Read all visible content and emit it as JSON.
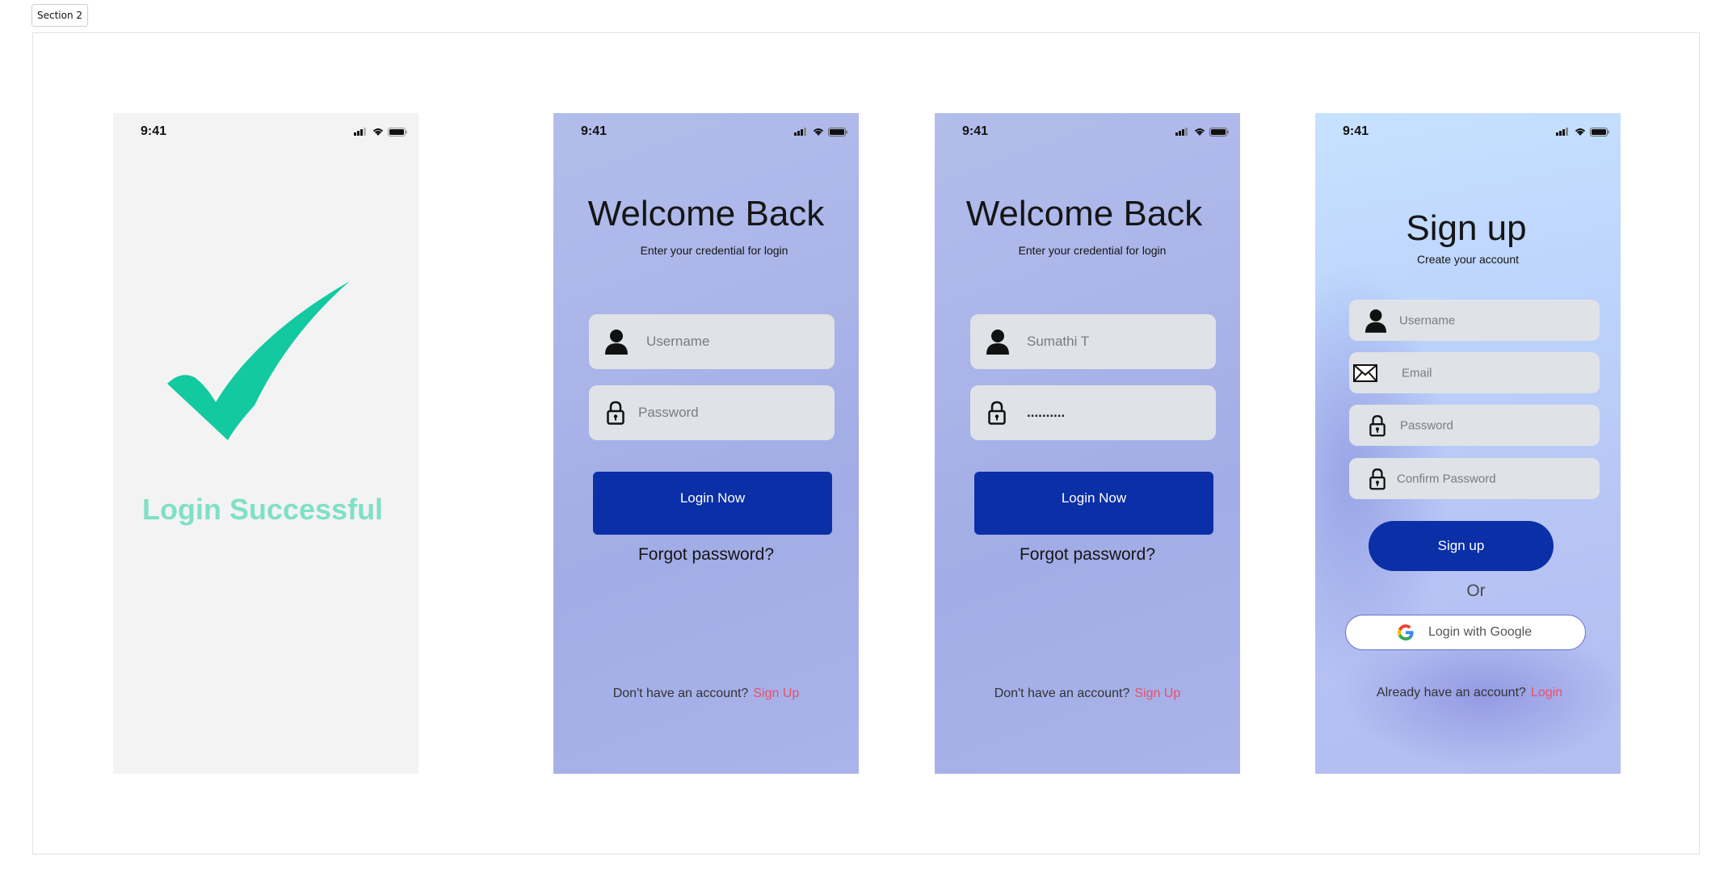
{
  "section_label": "Section 2",
  "status_bar": {
    "time": "9:41"
  },
  "screens": {
    "login_success": {
      "message": "Login Successful"
    },
    "login_empty": {
      "title": "Welcome Back",
      "subtitle": "Enter your credential for login",
      "username_placeholder": "Username",
      "password_placeholder": "Password",
      "login_button": "Login Now",
      "forgot_password": "Forgot password?",
      "footer_text": "Don't have an account?",
      "footer_link": "Sign Up"
    },
    "login_filled": {
      "title": "Welcome Back",
      "subtitle": "Enter your credential for login",
      "username_value": "Sumathi T",
      "password_value": "..........",
      "login_button": "Login Now",
      "forgot_password": "Forgot password?",
      "footer_text": "Don't have an account?",
      "footer_link": "Sign Up"
    },
    "signup": {
      "title": "Sign up",
      "subtitle": "Create your account",
      "username_placeholder": "Username",
      "email_placeholder": "Email",
      "password_placeholder": "Password",
      "confirm_password_placeholder": "Confirm Password",
      "signup_button": "Sign up",
      "or_text": "Or",
      "google_button": "Login with Google",
      "footer_text": "Already have an account?",
      "footer_link": "Login"
    }
  },
  "icons": {
    "checkmark": "checkmark-icon",
    "user": "user-icon",
    "lock": "lock-icon",
    "email": "envelope-icon",
    "google": "google-icon",
    "signal": "signal-icon",
    "wifi": "wifi-icon",
    "battery": "battery-icon"
  },
  "colors": {
    "primary_button": "#0b2fa6",
    "success_text": "#7fe0c6",
    "checkmark": "#13c9a0",
    "link": "#e8506a",
    "field_bg": "#dfe2e6"
  }
}
